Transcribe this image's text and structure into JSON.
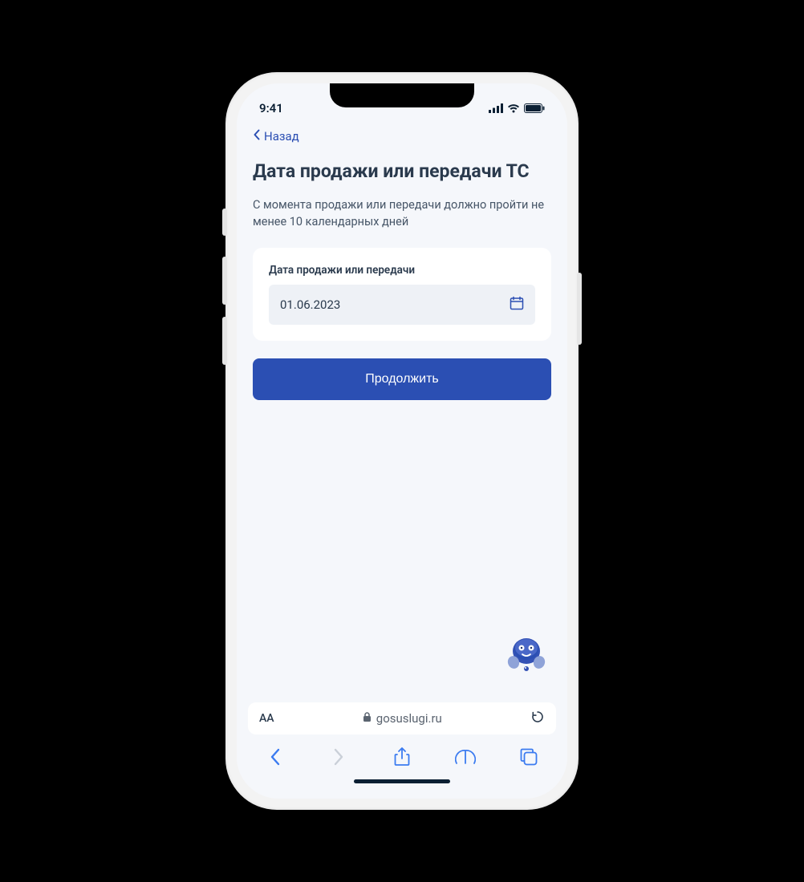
{
  "status": {
    "time": "9:41"
  },
  "nav": {
    "back_label": "Назад"
  },
  "page": {
    "title": "Дата продажи или передачи ТС",
    "subtitle": "С момента продажи или передачи должно пройти не менее 10 календарных дней"
  },
  "form": {
    "date_label": "Дата продажи или передачи",
    "date_value": "01.06.2023"
  },
  "actions": {
    "continue_label": "Продолжить"
  },
  "browser": {
    "url": "gosuslugi.ru",
    "text_size": "AА"
  }
}
